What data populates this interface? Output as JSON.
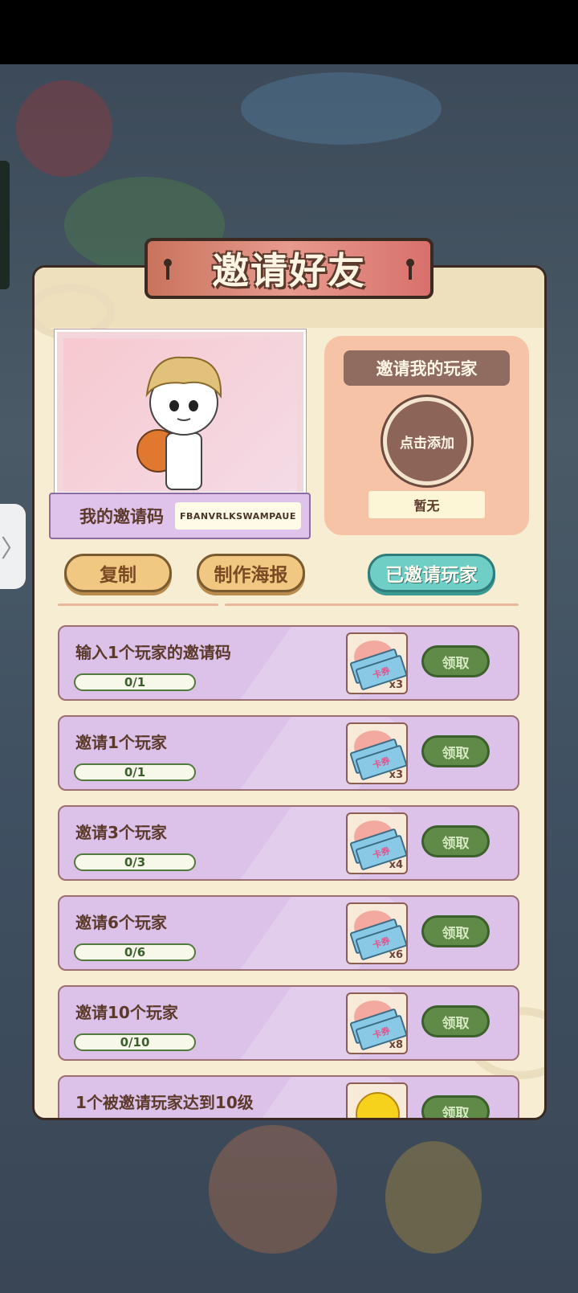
{
  "title": "邀请好友",
  "invite_code": {
    "label": "我的邀请码",
    "value": "FBANVRLKSWAMPAUE"
  },
  "inviter": {
    "header": "邀请我的玩家",
    "add_label": "点击添加",
    "current": "暂无"
  },
  "actions": {
    "copy": "复制",
    "poster": "制作海报",
    "invited": "已邀请玩家"
  },
  "tasks": [
    {
      "title": "输入1个玩家的邀请码",
      "progress": "0/1",
      "reward_name": "卡券",
      "reward_qty": "x3",
      "reward_type": "ticket",
      "claim": "领取"
    },
    {
      "title": "邀请1个玩家",
      "progress": "0/1",
      "reward_name": "卡券",
      "reward_qty": "x3",
      "reward_type": "ticket",
      "claim": "领取"
    },
    {
      "title": "邀请3个玩家",
      "progress": "0/3",
      "reward_name": "卡券",
      "reward_qty": "x4",
      "reward_type": "ticket",
      "claim": "领取"
    },
    {
      "title": "邀请6个玩家",
      "progress": "0/6",
      "reward_name": "卡券",
      "reward_qty": "x6",
      "reward_type": "ticket",
      "claim": "领取"
    },
    {
      "title": "邀请10个玩家",
      "progress": "0/10",
      "reward_name": "卡券",
      "reward_qty": "x8",
      "reward_type": "ticket",
      "claim": "领取"
    },
    {
      "title": "1个被邀请玩家达到10级",
      "reward_type": "coin",
      "claim": "领取"
    }
  ],
  "colors": {
    "panel": "#f6edd2",
    "task_row": "#dcc2e8",
    "claim_button": "#5f8a48",
    "banner": "#e79a8e"
  },
  "icons": {
    "side_tab": "chevron-right-icon",
    "ticket": "ticket-icon",
    "coin": "coin-icon",
    "keyhole": "keyhole-icon"
  }
}
